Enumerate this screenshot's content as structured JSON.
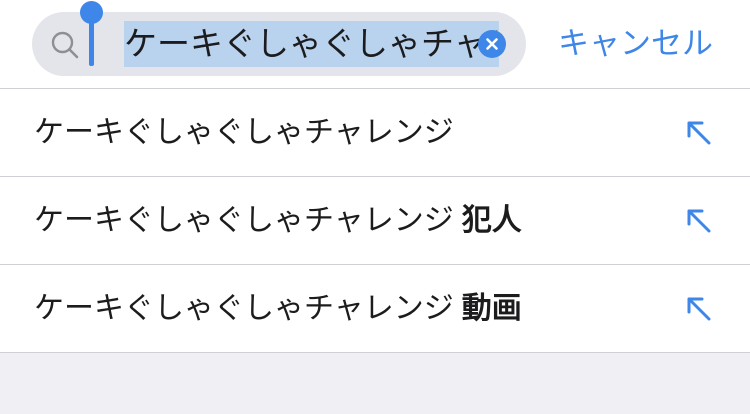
{
  "search": {
    "query": "ケーキぐしゃぐしゃチャレ",
    "icon": "search-icon",
    "clear_icon": "clear-icon"
  },
  "cancel_label": "キャンセル",
  "suggestions": [
    {
      "text": "ケーキぐしゃぐしゃチャレンジ",
      "suffix": ""
    },
    {
      "text": "ケーキぐしゃぐしゃチャレンジ",
      "suffix": "犯人"
    },
    {
      "text": "ケーキぐしゃぐしゃチャレンジ",
      "suffix": "動画"
    }
  ],
  "colors": {
    "accent": "#3e86e8",
    "selection": "#b9d3ee",
    "search_bg": "#e4e5ea",
    "page_bg": "#efeff4"
  }
}
